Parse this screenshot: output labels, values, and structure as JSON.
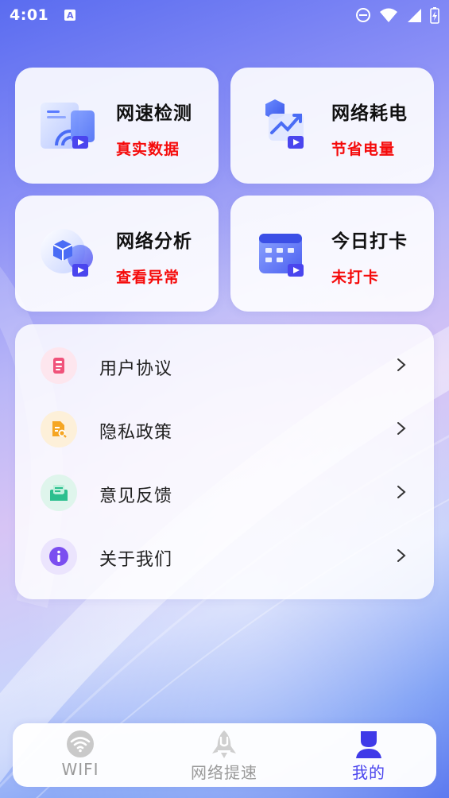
{
  "status_bar": {
    "time": "4:01",
    "icons": [
      "a-badge-icon",
      "dnd-icon",
      "wifi-icon",
      "signal-icon",
      "battery-charging-icon"
    ]
  },
  "cards": [
    {
      "title": "网速检测",
      "subtitle": "真实数据",
      "icon": "speed-test-icon"
    },
    {
      "title": "网络耗电",
      "subtitle": "节省电量",
      "icon": "power-usage-icon"
    },
    {
      "title": "网络分析",
      "subtitle": "查看异常",
      "icon": "network-analysis-icon"
    },
    {
      "title": "今日打卡",
      "subtitle": "未打卡",
      "icon": "calendar-checkin-icon"
    }
  ],
  "menu": [
    {
      "label": "用户协议",
      "icon": "document-icon",
      "color": "#f0527a"
    },
    {
      "label": "隐私政策",
      "icon": "file-search-icon",
      "color": "#f5a623"
    },
    {
      "label": "意见反馈",
      "icon": "feedback-mail-icon",
      "color": "#2bbf8e"
    },
    {
      "label": "关于我们",
      "icon": "info-icon",
      "color": "#7b4ef0"
    }
  ],
  "tabs": [
    {
      "label": "WIFI",
      "icon": "wifi-tab-icon",
      "active": false
    },
    {
      "label": "网络提速",
      "icon": "rocket-icon",
      "active": false
    },
    {
      "label": "我的",
      "icon": "profile-icon",
      "active": true
    }
  ],
  "colors": {
    "accent": "#4a45ee",
    "subtitle_red": "#f50a0a",
    "inactive_tab": "#9a9a9a"
  }
}
